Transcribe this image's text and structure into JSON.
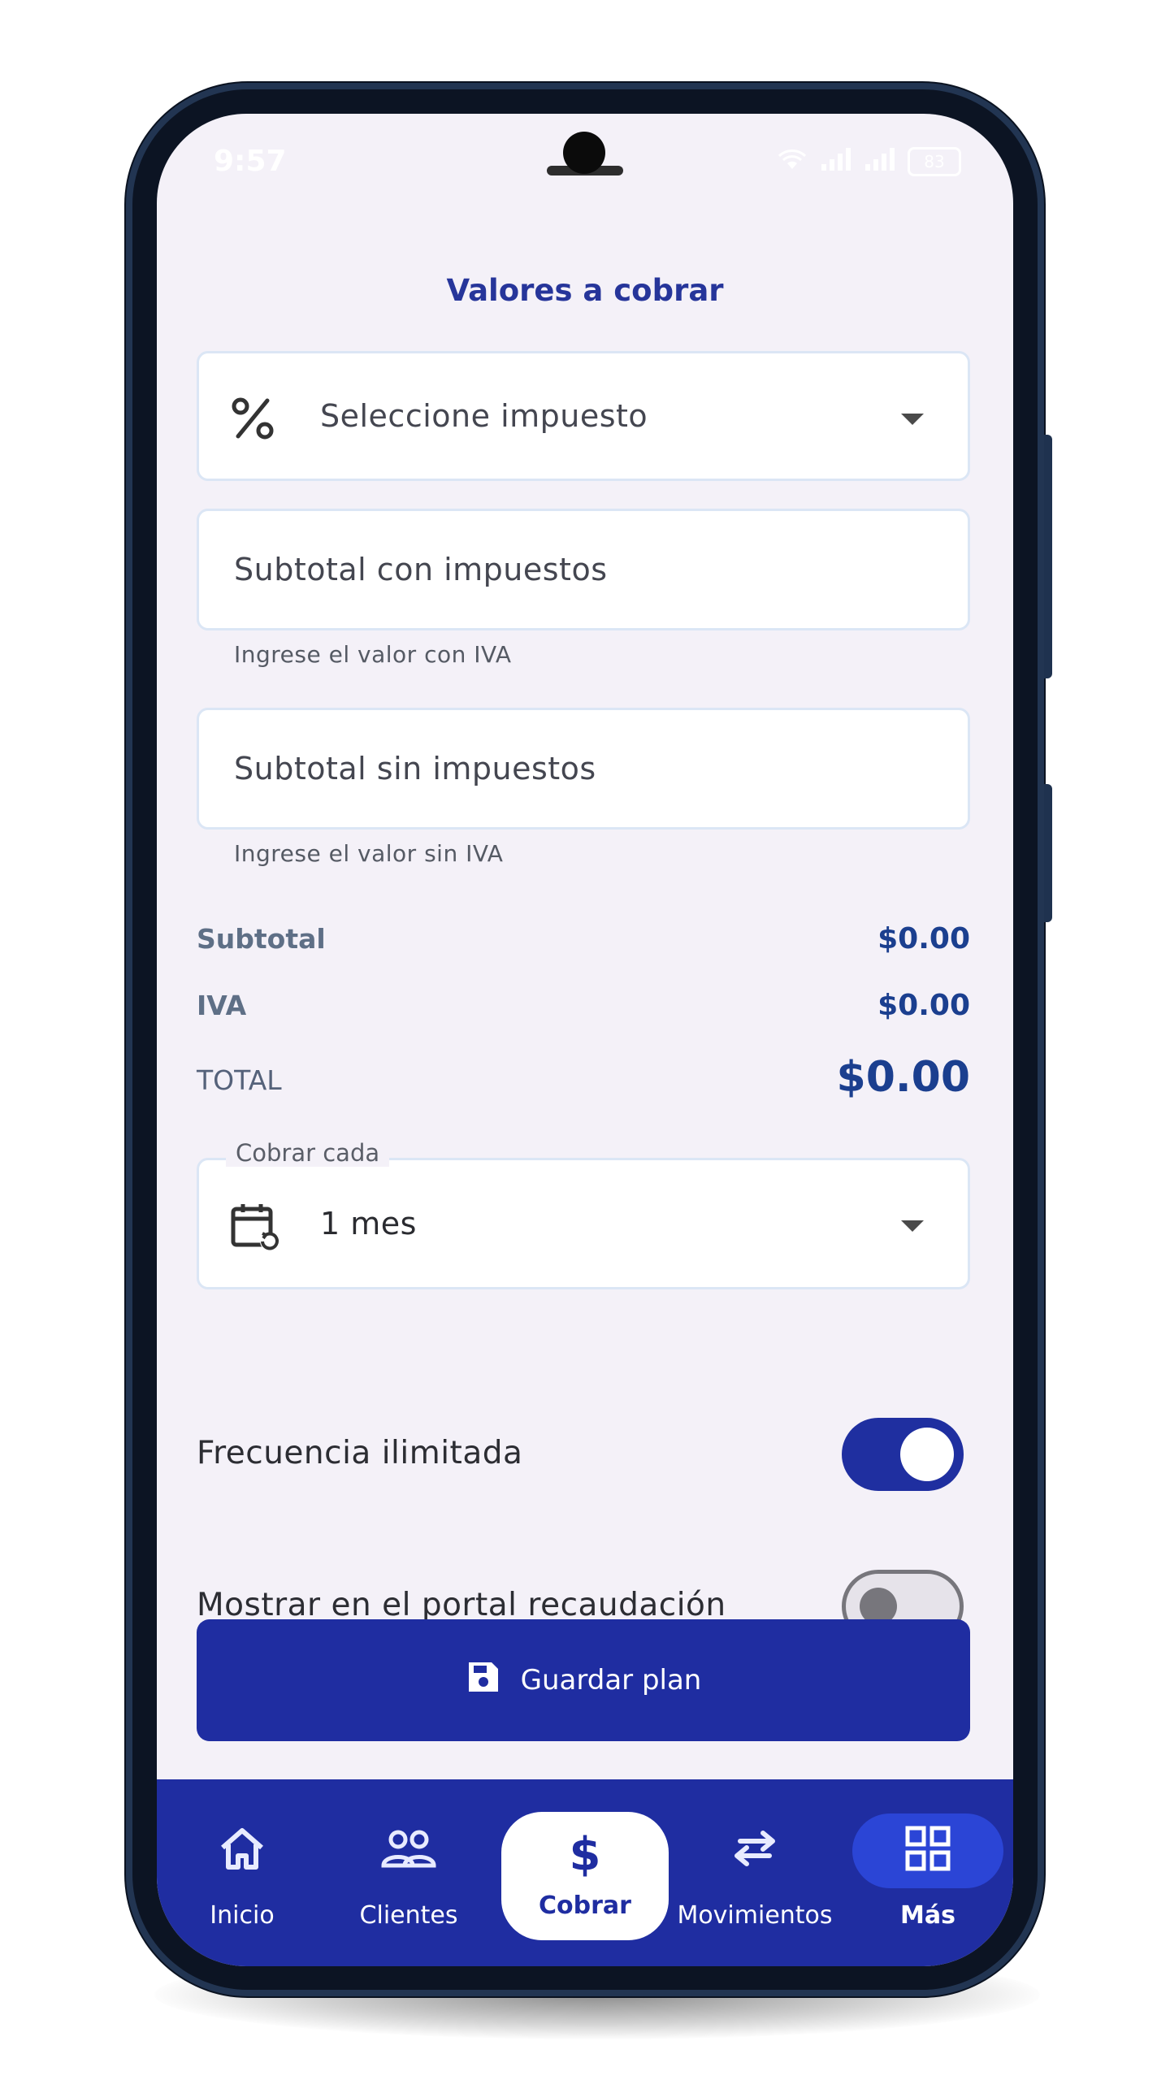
{
  "status_bar": {
    "time": "9:57",
    "battery": "83"
  },
  "page": {
    "title": "Valores a cobrar"
  },
  "tax_select": {
    "icon": "percent-icon",
    "placeholder": "Seleccione impuesto"
  },
  "subtotal_with_tax": {
    "placeholder": "Subtotal con impuestos",
    "helper": "Ingrese el valor con IVA",
    "value": ""
  },
  "subtotal_without_tax": {
    "placeholder": "Subtotal sin impuestos",
    "helper": "Ingrese el valor sin IVA",
    "value": ""
  },
  "summary": {
    "subtotal_label": "Subtotal",
    "subtotal_value": "$0.00",
    "iva_label": "IVA",
    "iva_value": "$0.00",
    "total_label": "TOTAL",
    "total_value": "$0.00"
  },
  "frequency": {
    "legend": "Cobrar cada",
    "icon": "calendar-repeat-icon",
    "value": "1 mes"
  },
  "toggles": {
    "unlimited": {
      "label": "Frecuencia ilimitada",
      "on": true
    },
    "portal": {
      "label": "Mostrar en el portal recaudación",
      "on": false
    }
  },
  "save_button": {
    "label": "Guardar plan",
    "icon": "save-icon"
  },
  "nav": {
    "items": [
      {
        "label": "Inicio",
        "icon": "home-icon"
      },
      {
        "label": "Clientes",
        "icon": "users-icon"
      },
      {
        "label": "Cobrar",
        "icon": "dollar-icon",
        "symbol": "$"
      },
      {
        "label": "Movimientos",
        "icon": "transfer-arrows-icon"
      },
      {
        "label": "Más",
        "icon": "grid-icon"
      }
    ],
    "active": "Cobrar"
  },
  "colors": {
    "primary": "#1f2da1",
    "title": "#26359a",
    "amount": "#1b3f8f",
    "background": "#f4f1f8"
  }
}
